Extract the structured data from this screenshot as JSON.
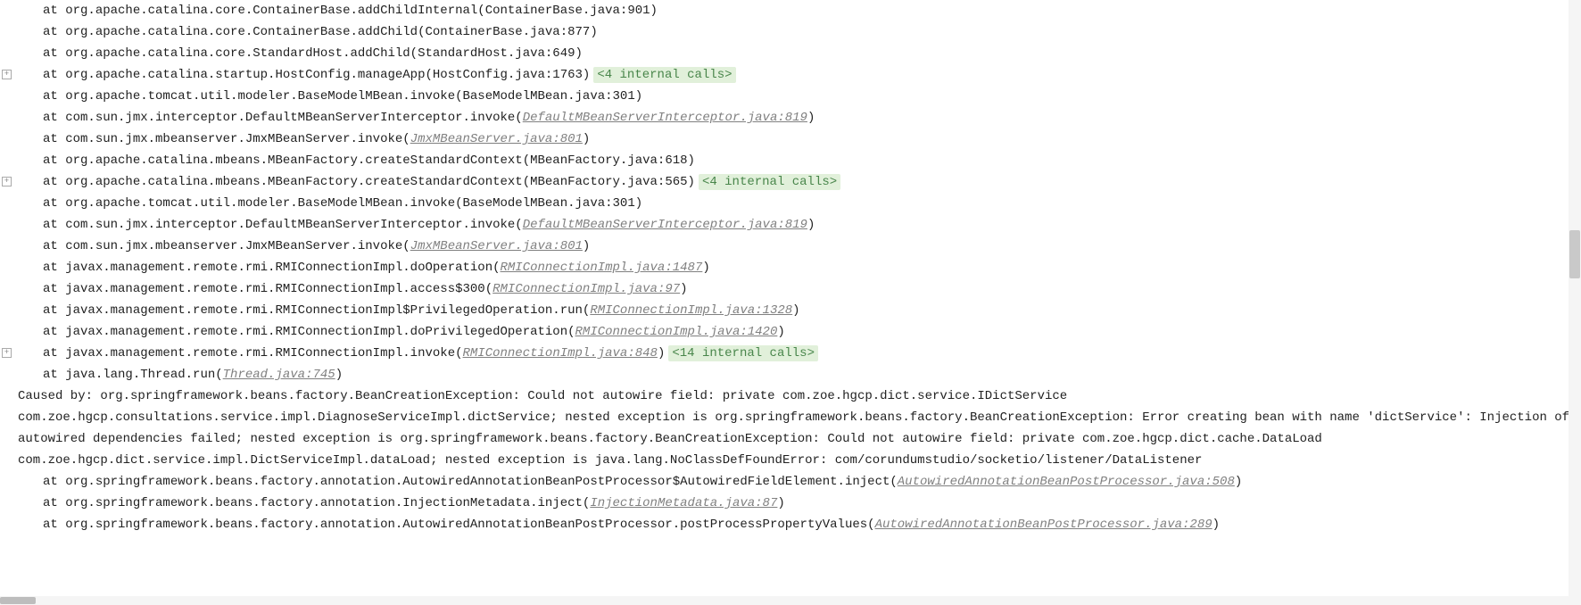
{
  "gutters": [
    {
      "line_index": 3
    },
    {
      "line_index": 8
    },
    {
      "line_index": 16
    }
  ],
  "lines": [
    {
      "type": "trace",
      "prefix": "at ",
      "text": "org.apache.catalina.core.ContainerBase.addChildInternal(ContainerBase.java:901)"
    },
    {
      "type": "trace",
      "prefix": "at ",
      "text": "org.apache.catalina.core.ContainerBase.addChild(ContainerBase.java:877)"
    },
    {
      "type": "trace",
      "prefix": "at ",
      "text": "org.apache.catalina.core.StandardHost.addChild(StandardHost.java:649)"
    },
    {
      "type": "trace_internal",
      "prefix": "at ",
      "text": "org.apache.catalina.startup.HostConfig.manageApp(HostConfig.java:1763)",
      "internal": "<4 internal calls>"
    },
    {
      "type": "trace",
      "prefix": "at ",
      "text": "org.apache.tomcat.util.modeler.BaseModelMBean.invoke(BaseModelMBean.java:301)"
    },
    {
      "type": "trace_link",
      "prefix": "at ",
      "text_before": "com.sun.jmx.interceptor.DefaultMBeanServerInterceptor.invoke(",
      "link": "DefaultMBeanServerInterceptor.java:819",
      "text_after": ")"
    },
    {
      "type": "trace_link",
      "prefix": "at ",
      "text_before": "com.sun.jmx.mbeanserver.JmxMBeanServer.invoke(",
      "link": "JmxMBeanServer.java:801",
      "text_after": ")"
    },
    {
      "type": "trace",
      "prefix": "at ",
      "text": "org.apache.catalina.mbeans.MBeanFactory.createStandardContext(MBeanFactory.java:618)"
    },
    {
      "type": "trace_internal",
      "prefix": "at ",
      "text": "org.apache.catalina.mbeans.MBeanFactory.createStandardContext(MBeanFactory.java:565)",
      "internal": "<4 internal calls>"
    },
    {
      "type": "trace",
      "prefix": "at ",
      "text": "org.apache.tomcat.util.modeler.BaseModelMBean.invoke(BaseModelMBean.java:301)"
    },
    {
      "type": "trace_link",
      "prefix": "at ",
      "text_before": "com.sun.jmx.interceptor.DefaultMBeanServerInterceptor.invoke(",
      "link": "DefaultMBeanServerInterceptor.java:819",
      "text_after": ")"
    },
    {
      "type": "trace_link",
      "prefix": "at ",
      "text_before": "com.sun.jmx.mbeanserver.JmxMBeanServer.invoke(",
      "link": "JmxMBeanServer.java:801",
      "text_after": ")"
    },
    {
      "type": "trace_link",
      "prefix": "at ",
      "text_before": "javax.management.remote.rmi.RMIConnectionImpl.doOperation(",
      "link": "RMIConnectionImpl.java:1487",
      "text_after": ")"
    },
    {
      "type": "trace_link",
      "prefix": "at ",
      "text_before": "javax.management.remote.rmi.RMIConnectionImpl.access$300(",
      "link": "RMIConnectionImpl.java:97",
      "text_after": ")"
    },
    {
      "type": "trace_link",
      "prefix": "at ",
      "text_before": "javax.management.remote.rmi.RMIConnectionImpl$PrivilegedOperation.run(",
      "link": "RMIConnectionImpl.java:1328",
      "text_after": ")"
    },
    {
      "type": "trace_link",
      "prefix": "at ",
      "text_before": "javax.management.remote.rmi.RMIConnectionImpl.doPrivilegedOperation(",
      "link": "RMIConnectionImpl.java:1420",
      "text_after": ")"
    },
    {
      "type": "trace_link_internal",
      "prefix": "at ",
      "text_before": "javax.management.remote.rmi.RMIConnectionImpl.invoke(",
      "link": "RMIConnectionImpl.java:848",
      "text_after": ")",
      "internal": "<14 internal calls>"
    },
    {
      "type": "trace_link",
      "prefix": "at ",
      "text_before": "java.lang.Thread.run(",
      "link": "Thread.java:745",
      "text_after": ")"
    },
    {
      "type": "caused",
      "text": "Caused by: org.springframework.beans.factory.BeanCreationException: Could not autowire field: private com.zoe.hgcp.dict.service.IDictService com.zoe.hgcp.consultations.service.impl.DiagnoseServiceImpl.dictService; nested exception is org.springframework.beans.factory.BeanCreationException: Error creating bean with name 'dictService': Injection of autowired dependencies failed; nested exception is org.springframework.beans.factory.BeanCreationException: Could not autowire field: private com.zoe.hgcp.dict.cache.DataLoad com.zoe.hgcp.dict.service.impl.DictServiceImpl.dataLoad; nested exception is java.lang.NoClassDefFoundError: com/corundumstudio/socketio/listener/DataListener"
    },
    {
      "type": "trace_link",
      "prefix": "at ",
      "text_before": "org.springframework.beans.factory.annotation.AutowiredAnnotationBeanPostProcessor$AutowiredFieldElement.inject(",
      "link": "AutowiredAnnotationBeanPostProcessor.java:508",
      "text_after": ")"
    },
    {
      "type": "trace_link",
      "prefix": "at ",
      "text_before": "org.springframework.beans.factory.annotation.InjectionMetadata.inject(",
      "link": "InjectionMetadata.java:87",
      "text_after": ")"
    },
    {
      "type": "trace_link",
      "prefix": "at ",
      "text_before": "org.springframework.beans.factory.annotation.AutowiredAnnotationBeanPostProcessor.postProcessPropertyValues(",
      "link": "AutowiredAnnotationBeanPostProcessor.java:289",
      "text_after": ")"
    }
  ],
  "scrollbar": {
    "thumb_top_pct": 38,
    "thumb_height_pct": 8
  }
}
